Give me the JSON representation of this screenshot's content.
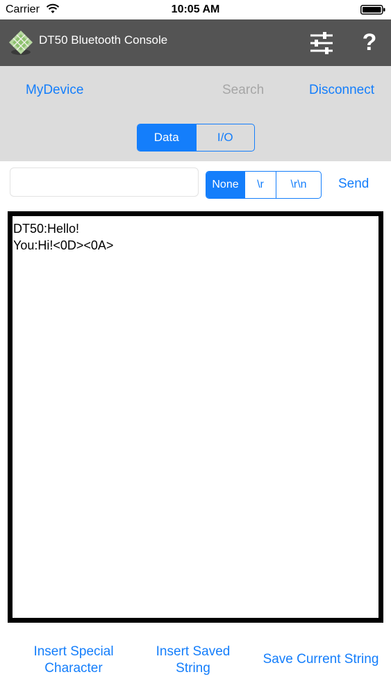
{
  "status_bar": {
    "carrier": "Carrier",
    "time": "10:05 AM",
    "wifi_icon": "wifi-icon",
    "battery_icon": "battery-icon"
  },
  "title_bar": {
    "title": "DT50 Bluetooth Console",
    "background_color": "#545454",
    "logo_icon": "app-logo-diamond",
    "settings_icon": "sliders-icon",
    "help_label": "?"
  },
  "device_bar": {
    "device_label": "MyDevice",
    "search_label": "Search",
    "disconnect_label": "Disconnect",
    "mode_tabs": [
      {
        "label": "Data",
        "selected": true
      },
      {
        "label": "I/O",
        "selected": false
      }
    ]
  },
  "input_row": {
    "input_value": "",
    "line_endings": [
      {
        "label": "None",
        "selected": true
      },
      {
        "label": "\\r",
        "selected": false
      },
      {
        "label": "\\r\\n",
        "selected": false
      }
    ],
    "send_label": "Send"
  },
  "console": {
    "lines": [
      "DT50:Hello!",
      "You:Hi!<0D><0A>"
    ]
  },
  "bottom_actions": {
    "insert_special_line1": "Insert Special",
    "insert_special_line2": "Character",
    "insert_saved_line1": "Insert Saved",
    "insert_saved_line2": "String",
    "save_current": "Save Current String"
  },
  "colors": {
    "accent": "#147efb",
    "disabled": "#a6a6a6",
    "toolbar_bg": "#dcdcdc"
  }
}
